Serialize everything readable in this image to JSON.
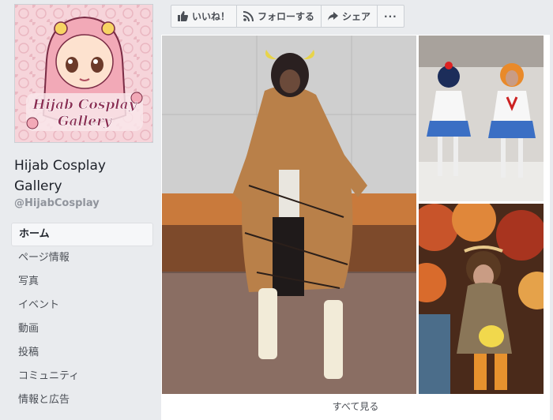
{
  "sidebar": {
    "avatar_logo_text": "Hijab Cosplay Gallery",
    "page_name": "Hijab Cosplay Gallery",
    "username": "@HijabCosplay",
    "nav": [
      {
        "label": "ホーム",
        "active": true
      },
      {
        "label": "ページ情報"
      },
      {
        "label": "写真"
      },
      {
        "label": "イベント"
      },
      {
        "label": "動画"
      },
      {
        "label": "投稿"
      },
      {
        "label": "コミュニティ"
      },
      {
        "label": "情報と広告"
      }
    ]
  },
  "actions": {
    "like_label": "いいね！",
    "follow_label": "フォローする",
    "share_label": "シェア",
    "more_label": "···"
  },
  "photos": {
    "see_all_label": "すべて見る"
  }
}
